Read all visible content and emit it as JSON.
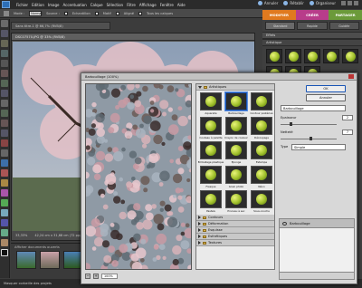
{
  "menubar": {
    "items": [
      "Fichier",
      "Edition",
      "Image",
      "Accentuation",
      "Calque",
      "Sélection",
      "Filtre",
      "Affichage",
      "Fenêtre",
      "Aide"
    ],
    "annuler": "Annuler",
    "retablir": "Rétablir",
    "organiseur": "Organiseur"
  },
  "options": {
    "mode_label": "Mode :",
    "mode_value": "Normal",
    "source_label": "Source :",
    "echantillon_label": "Echantillon",
    "motif_label": "Motif",
    "aligne_label": "Aligné",
    "tous_calques_label": "Tous les calques"
  },
  "modetabs": {
    "modifier": "MODIFIER",
    "creer": "CRÉER",
    "partager": "PARTAGER"
  },
  "doc": {
    "tab_title": "Sans titre-1 @ 66,7% (RVB/8)",
    "window_title": "DSC07570.JPG @ 33% (RVB/8)",
    "zoom": "33,33%",
    "info": "42,24 cm x 31,68 cm (72 ppp)"
  },
  "projbin": {
    "label": "Afficher documents ouverts"
  },
  "bottombar": {
    "text": "Masquer corbeille des projets"
  },
  "rightpanel": {
    "subtabs": [
      "Standard",
      "Rapide",
      "Guidée"
    ],
    "effects_title": "Effets",
    "artistic_label": "Artistique"
  },
  "dialog": {
    "title": "Barbouillage (100%)",
    "ok": "OK",
    "cancel": "Annuler",
    "filter_select": "Barbouillage",
    "epaisseur_label": "Epaisseur",
    "epaisseur_value": "2",
    "nettete_label": "Netteté",
    "nettete_value": "7",
    "type_label": "Type",
    "type_value": "Simple",
    "zoom_value": "100%",
    "layer_name": "Barbouillage"
  },
  "gallery": {
    "open_category": "Artistiques",
    "filters": [
      "Aquarelle",
      "Barbouillage",
      "Contour postérisé",
      "Couteau à palette",
      "Crayon de couleur",
      "Découpage",
      "Emballage plastique",
      "Eponge",
      "Estampe",
      "Fresque",
      "Grain photo",
      "Néon",
      "Pastels",
      "Pinceau à sec",
      "Sous-couche"
    ],
    "selected_index": 1,
    "categories": [
      "Contours",
      "Déformation",
      "Esquisse",
      "Esthétiques",
      "Textures"
    ]
  }
}
